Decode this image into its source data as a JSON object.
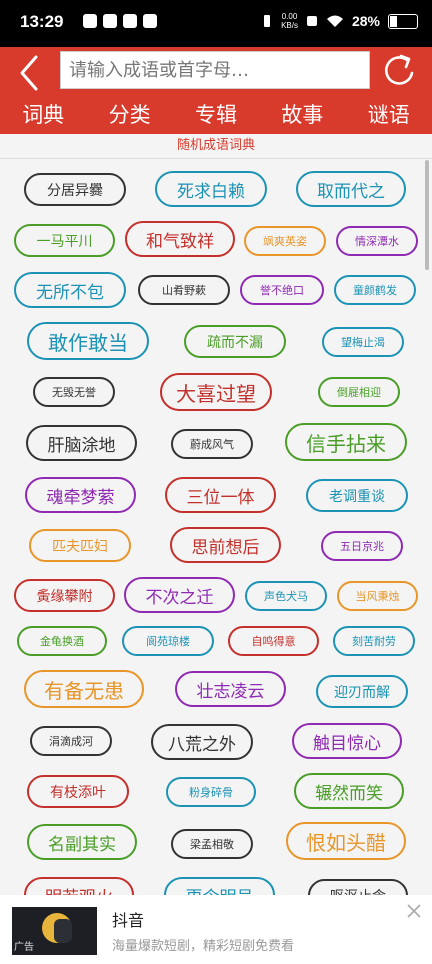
{
  "status": {
    "time": "13:29",
    "net_speed": "0.00",
    "net_unit": "KB/s",
    "battery": "28%"
  },
  "search": {
    "placeholder": "请输入成语或首字母…"
  },
  "tabs": [
    "词典",
    "分类",
    "专辑",
    "故事",
    "谜语"
  ],
  "subtitle": "随机成语词典",
  "colors": {
    "header": "#d83a2c",
    "dark": "#333333",
    "teal": "#1c93b4",
    "green": "#4a9e28",
    "red": "#c4302b",
    "orange": "#e8962a",
    "purple": "#8f2ab3"
  },
  "idioms": [
    {
      "text": "分居异爨",
      "color": "dark"
    },
    {
      "text": "死求白赖",
      "color": "teal"
    },
    {
      "text": "取而代之",
      "color": "teal"
    },
    {
      "text": "一马平川",
      "color": "green"
    },
    {
      "text": "和气致祥",
      "color": "red"
    },
    {
      "text": "飒爽英姿",
      "color": "orange"
    },
    {
      "text": "情深潭水",
      "color": "purple"
    },
    {
      "text": "无所不包",
      "color": "teal"
    },
    {
      "text": "山肴野蔌",
      "color": "dark"
    },
    {
      "text": "誉不绝口",
      "color": "purple"
    },
    {
      "text": "童颜鹤发",
      "color": "teal"
    },
    {
      "text": "敢作敢当",
      "color": "teal"
    },
    {
      "text": "疏而不漏",
      "color": "green"
    },
    {
      "text": "望梅止渴",
      "color": "teal"
    },
    {
      "text": "无毁无誉",
      "color": "dark"
    },
    {
      "text": "大喜过望",
      "color": "red"
    },
    {
      "text": "倒屣相迎",
      "color": "green"
    },
    {
      "text": "肝脑涂地",
      "color": "dark"
    },
    {
      "text": "蔚成风气",
      "color": "dark"
    },
    {
      "text": "信手拈来",
      "color": "green"
    },
    {
      "text": "魂牵梦萦",
      "color": "purple"
    },
    {
      "text": "三位一体",
      "color": "red"
    },
    {
      "text": "老调重谈",
      "color": "teal"
    },
    {
      "text": "匹夫匹妇",
      "color": "orange"
    },
    {
      "text": "思前想后",
      "color": "red"
    },
    {
      "text": "五日京兆",
      "color": "purple"
    },
    {
      "text": "夤缘攀附",
      "color": "red"
    },
    {
      "text": "不次之迁",
      "color": "purple"
    },
    {
      "text": "声色犬马",
      "color": "teal"
    },
    {
      "text": "当风秉烛",
      "color": "orange"
    },
    {
      "text": "金龟换酒",
      "color": "green"
    },
    {
      "text": "阆苑琼楼",
      "color": "teal"
    },
    {
      "text": "自鸣得意",
      "color": "red"
    },
    {
      "text": "刻苦耐劳",
      "color": "teal"
    },
    {
      "text": "有备无患",
      "color": "orange"
    },
    {
      "text": "壮志凌云",
      "color": "purple"
    },
    {
      "text": "迎刃而解",
      "color": "teal"
    },
    {
      "text": "涓滴成河",
      "color": "dark"
    },
    {
      "text": "八荒之外",
      "color": "dark"
    },
    {
      "text": "触目惊心",
      "color": "purple"
    },
    {
      "text": "有枝添叶",
      "color": "red"
    },
    {
      "text": "粉身碎骨",
      "color": "teal"
    },
    {
      "text": "辗然而笑",
      "color": "green"
    },
    {
      "text": "名副其实",
      "color": "green"
    },
    {
      "text": "梁孟相敬",
      "color": "dark"
    },
    {
      "text": "恨如头醋",
      "color": "orange"
    },
    {
      "text": "明若观火",
      "color": "red"
    },
    {
      "text": "更令明号",
      "color": "teal"
    },
    {
      "text": "呕沤止含",
      "color": "dark"
    }
  ],
  "ad": {
    "title": "抖音",
    "subtitle": "海量爆款短剧，精彩短剧免费看",
    "mark": "广告"
  }
}
